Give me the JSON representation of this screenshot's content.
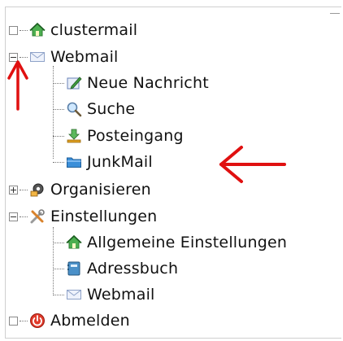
{
  "tree": {
    "items": [
      {
        "label": "clustermail",
        "icon": "home-icon",
        "state": "leaf"
      },
      {
        "label": "Webmail",
        "icon": "envelope-icon",
        "state": "expanded"
      },
      {
        "label": "Neue Nachricht",
        "icon": "compose-icon"
      },
      {
        "label": "Suche",
        "icon": "search-icon"
      },
      {
        "label": "Posteingang",
        "icon": "inbox-download-icon"
      },
      {
        "label": "JunkMail",
        "icon": "folder-icon"
      },
      {
        "label": "Organisieren",
        "icon": "gears-icon",
        "state": "collapsed"
      },
      {
        "label": "Einstellungen",
        "icon": "tools-icon",
        "state": "expanded"
      },
      {
        "label": "Allgemeine Einstellungen",
        "icon": "home-icon"
      },
      {
        "label": "Adressbuch",
        "icon": "address-book-icon"
      },
      {
        "label": "Webmail",
        "icon": "envelope-icon"
      },
      {
        "label": "Abmelden",
        "icon": "power-icon",
        "state": "leaf"
      }
    ]
  },
  "annotations": {
    "arrow_color": "#e01010"
  }
}
